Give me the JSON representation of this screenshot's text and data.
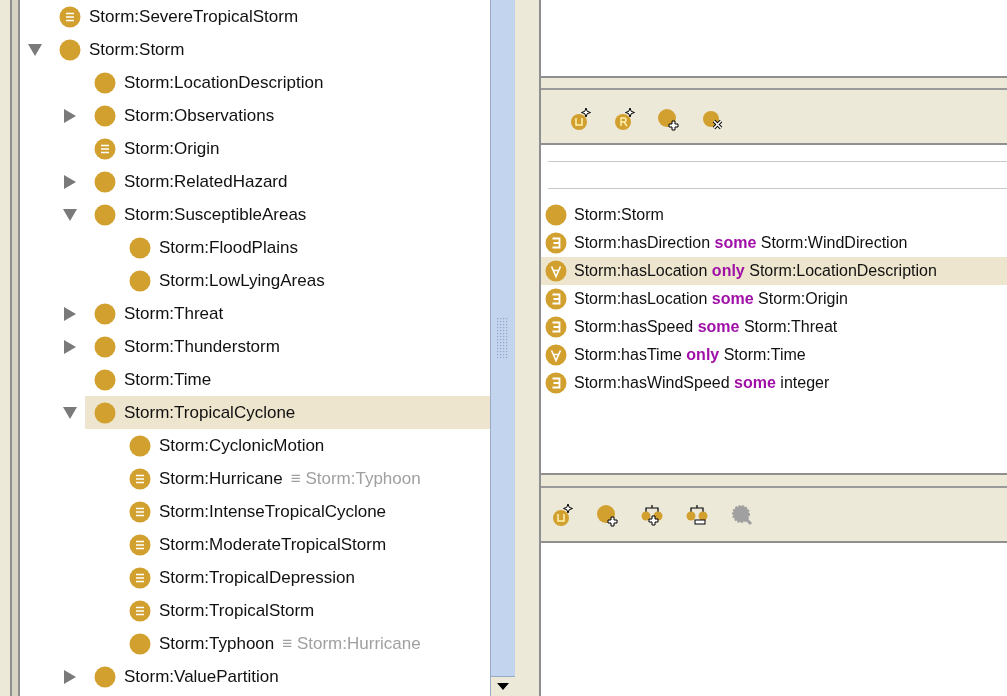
{
  "tree": [
    {
      "label": "Storm:SevereTropicalStorm",
      "kind": "defined",
      "selected": false
    },
    {
      "label": "Storm:Storm",
      "kind": "class",
      "expanded": true,
      "selected": false,
      "children": [
        {
          "label": "Storm:LocationDescription",
          "kind": "class",
          "selected": false
        },
        {
          "label": "Storm:Observations",
          "kind": "class",
          "expanded": false,
          "selected": false
        },
        {
          "label": "Storm:Origin",
          "kind": "defined",
          "selected": false
        },
        {
          "label": "Storm:RelatedHazard",
          "kind": "class",
          "expanded": false,
          "selected": false
        },
        {
          "label": "Storm:SusceptibleAreas",
          "kind": "class",
          "expanded": true,
          "selected": false,
          "children": [
            {
              "label": "Storm:FloodPlains",
              "kind": "class",
              "selected": false
            },
            {
              "label": "Storm:LowLyingAreas",
              "kind": "class",
              "selected": false
            }
          ]
        },
        {
          "label": "Storm:Threat",
          "kind": "class",
          "expanded": false,
          "selected": false
        },
        {
          "label": "Storm:Thunderstorm",
          "kind": "class",
          "expanded": false,
          "selected": false
        },
        {
          "label": "Storm:Time",
          "kind": "class",
          "selected": false
        },
        {
          "label": "Storm:TropicalCyclone",
          "kind": "class",
          "expanded": true,
          "selected": true,
          "children": [
            {
              "label": "Storm:CyclonicMotion",
              "kind": "class",
              "selected": false
            },
            {
              "label": "Storm:Hurricane",
              "kind": "defined",
              "equivalent": "≡ Storm:Typhoon",
              "selected": false
            },
            {
              "label": "Storm:IntenseTropicalCyclone",
              "kind": "defined",
              "selected": false
            },
            {
              "label": "Storm:ModerateTropicalStorm",
              "kind": "defined",
              "selected": false
            },
            {
              "label": "Storm:TropicalDepression",
              "kind": "defined",
              "selected": false
            },
            {
              "label": "Storm:TropicalStorm",
              "kind": "defined",
              "selected": false
            },
            {
              "label": "Storm:Typhoon",
              "kind": "class",
              "equivalent": "≡ Storm:Hurricane",
              "selected": false
            }
          ]
        },
        {
          "label": "Storm:ValuePartition",
          "kind": "class",
          "expanded": false,
          "selected": false
        }
      ]
    }
  ],
  "upper_toolbar": [
    {
      "kind": "add-union",
      "disabled": false
    },
    {
      "kind": "add-restriction",
      "disabled": false
    },
    {
      "kind": "add-class",
      "disabled": false
    },
    {
      "kind": "delete",
      "disabled": false
    }
  ],
  "class_list": [
    {
      "kind": "class",
      "label": "Storm:Storm",
      "selected": false
    },
    {
      "kind": "some",
      "property": "Storm:hasDirection",
      "keyword": "some",
      "filler": "Storm:WindDirection",
      "selected": false
    },
    {
      "kind": "only",
      "property": "Storm:hasLocation",
      "keyword": "only",
      "filler": "Storm:LocationDescription",
      "selected": true
    },
    {
      "kind": "some",
      "property": "Storm:hasLocation",
      "keyword": "some",
      "filler": "Storm:Origin",
      "selected": false
    },
    {
      "kind": "some",
      "property": "Storm:hasSpeed",
      "keyword": "some",
      "filler": "Storm:Threat",
      "selected": false
    },
    {
      "kind": "only",
      "property": "Storm:hasTime",
      "keyword": "only",
      "filler": "Storm:Time",
      "selected": false
    },
    {
      "kind": "some",
      "property": "Storm:hasWindSpeed",
      "keyword": "some",
      "filler": "integer",
      "selected": false
    }
  ],
  "lower_toolbar": [
    {
      "kind": "add-union",
      "disabled": false
    },
    {
      "kind": "add-class",
      "disabled": false
    },
    {
      "kind": "add-sibling",
      "disabled": false
    },
    {
      "kind": "remove-sibling",
      "disabled": false
    },
    {
      "kind": "find",
      "disabled": true
    }
  ]
}
